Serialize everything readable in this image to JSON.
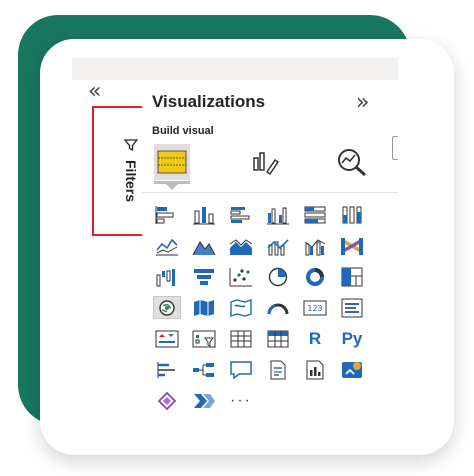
{
  "pane": {
    "collapse_glyph": "«",
    "filters_label": "Filters",
    "title": "Visualizations",
    "expand_glyph": "»",
    "section_label": "Build visual",
    "modes": [
      "build-visual-icon",
      "format-visual-icon",
      "analytics-icon"
    ],
    "more_glyph": "···",
    "custom_labels": {
      "r": "R",
      "py": "Py"
    }
  },
  "visuals": [
    "stacked-bar-chart-icon",
    "stacked-column-chart-icon",
    "clustered-bar-chart-icon",
    "clustered-column-chart-icon",
    "100-stacked-bar-chart-icon",
    "100-stacked-column-chart-icon",
    "line-chart-icon",
    "area-chart-icon",
    "stacked-area-chart-icon",
    "line-and-stacked-column-chart-icon",
    "line-and-clustered-column-chart-icon",
    "ribbon-chart-icon",
    "waterfall-chart-icon",
    "funnel-icon",
    "scatter-chart-icon",
    "pie-chart-icon",
    "donut-chart-icon",
    "treemap-icon",
    "map-icon",
    "filled-map-icon",
    "shape-map-icon",
    "gauge-icon",
    "card-icon",
    "multi-row-card-icon",
    "kpi-icon",
    "slicer-icon",
    "table-icon",
    "matrix-icon",
    "r-visual-icon",
    "python-visual-icon",
    "key-influencers-icon",
    "decomposition-tree-icon",
    "qa-icon",
    "smart-narrative-icon",
    "paginated-report-icon",
    "power-apps-icon",
    "power-automate-icon",
    "arcgis-icon",
    "more-visuals-icon"
  ],
  "colors": {
    "accent_green": "#18785f",
    "highlight_red": "#d92328",
    "icon_blue": "#1e6ab8",
    "icon_yellow": "#e8b900"
  }
}
